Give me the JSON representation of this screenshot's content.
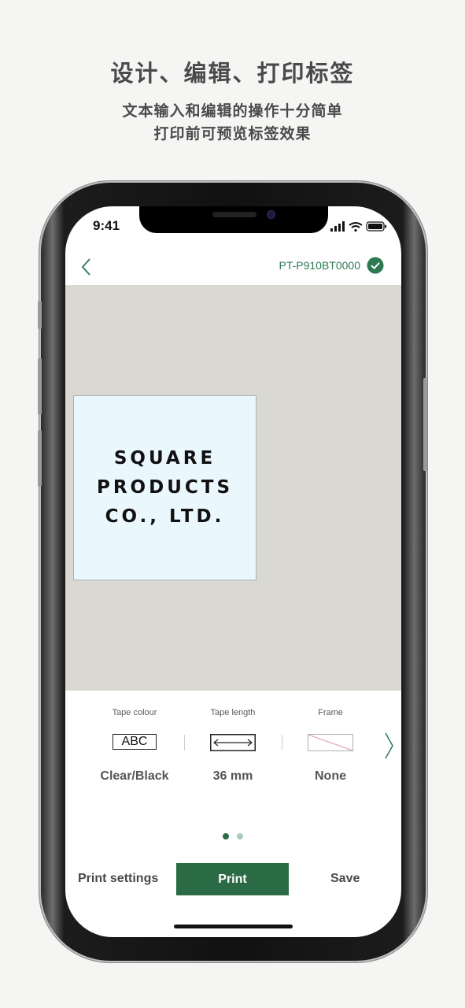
{
  "promo": {
    "title": "设计、编辑、打印标签",
    "subtitle_line1": "文本输入和编辑的操作十分简单",
    "subtitle_line2": "打印前可预览标签效果"
  },
  "status_bar": {
    "time": "9:41"
  },
  "header": {
    "device_name": "PT-P910BT0000"
  },
  "label": {
    "lines": [
      "SQUARE",
      "PRODUCTS",
      "CO., LTD."
    ]
  },
  "properties": [
    {
      "title": "Tape colour",
      "icon": "abc-tape-icon",
      "icon_text": "ABC",
      "value": "Clear/Black"
    },
    {
      "title": "Tape length",
      "icon": "length-arrow-icon",
      "value": "36 mm"
    },
    {
      "title": "Frame",
      "icon": "no-frame-icon",
      "value": "None"
    }
  ],
  "pager": {
    "count": 2,
    "active": 0
  },
  "bottom_bar": {
    "print_settings_label": "Print settings",
    "print_label": "Print",
    "save_label": "Save"
  },
  "colors": {
    "accent": "#2a6b45",
    "device_name": "#2d7a52",
    "canvas": "#d9d8d3",
    "label_bg": "#eaf7fc"
  }
}
